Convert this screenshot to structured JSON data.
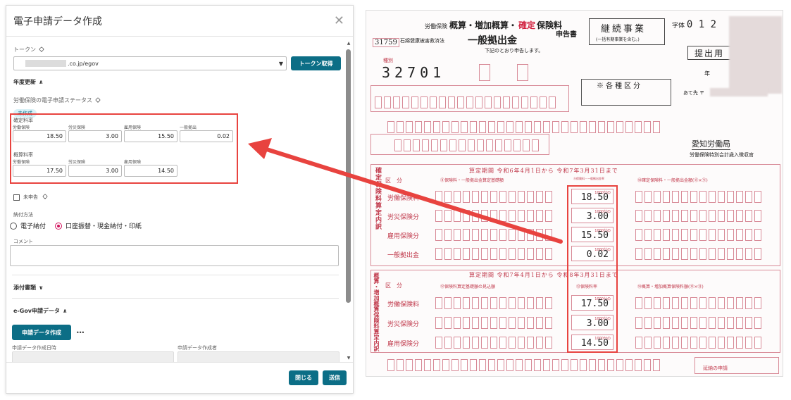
{
  "dialog": {
    "title": "電子申請データ作成",
    "token_label": "トークン",
    "token_value_suffix": ".co.jp/egov",
    "token_button": "トークン取得",
    "annual_update_header": "年度更新",
    "status_label": "労働保険の電子申請ステータス",
    "status_badge": "未作成",
    "fixed_rate_label": "確定料率",
    "fixed_rates": [
      {
        "label": "労働保険",
        "value": "18.50"
      },
      {
        "label": "労災保険",
        "value": "3.00"
      },
      {
        "label": "雇用保険",
        "value": "15.50"
      },
      {
        "label": "一般拠出",
        "value": "0.02"
      }
    ],
    "estimated_rate_label": "概算料率",
    "estimated_rates": [
      {
        "label": "労働保険",
        "value": "17.50"
      },
      {
        "label": "労災保険",
        "value": "3.00"
      },
      {
        "label": "雇用保険",
        "value": "14.50"
      }
    ],
    "not_applied_label": "未申告",
    "payment_method_label": "納付方法",
    "payment_options": [
      "電子納付",
      "口座振替・現金納付・印紙"
    ],
    "payment_selected": "口座振替・現金納付・印紙",
    "comment_label": "コメント",
    "attachments_header": "添付書類",
    "egov_header": "e-Gov申請データ",
    "create_button": "申請データ作成",
    "more_label": "•••",
    "created_at_label": "申請データ作成日時",
    "created_by_label": "申請データ作成者",
    "close_button": "閉じる",
    "send_button": "送信"
  },
  "form": {
    "code": "31759",
    "title_prefix": "労働保険",
    "title_main": "概算・増加概算・",
    "title_confirm": "確定",
    "title_insurance": "保険料",
    "title_sub": "石綿健康被害救済法",
    "title_levy": "一般拠出金",
    "title_report": "申告書",
    "continuing_business": "継続事業",
    "continuing_note": "(一括有期事業を含む。)",
    "submit_label": "提出用",
    "intro_line": "下記のとおり申告します。",
    "number_label": "種別",
    "type_number": "32701",
    "classification": "※各種区分",
    "addressee": "あて先 〒",
    "office": "愛知労働局",
    "office_sub": "労働保険特別会計歳入徴収官",
    "era_label": "年",
    "confirm_section_vertical": "確定保険料算定内訳",
    "estimate_section_vertical": "概算・増加概算保険料算定内訳",
    "period_confirm": "算定期間 令和6年4月1日から 令和7年3月31日まで",
    "period_estimate": "算定期間 令和7年4月1日から 令和8年3月31日まで",
    "col_base": "⑧保険料・一般拠出金算定基礎額",
    "col_rate": "⑨保険料・一般拠出金率",
    "col_amount": "⑩確定保険料・一般拠出金額(⑧×⑨)",
    "col_base2": "⑫保険料算定基礎額の見込額",
    "col_rate2": "⑬保険料率",
    "col_amount2": "⑭概算・増加概算保険料額(⑫×⑬)",
    "kubun": "区　分",
    "confirm_rows": [
      {
        "label": "労働保険料",
        "rate": "18.50"
      },
      {
        "label": "労災保険分",
        "rate": "3.00"
      },
      {
        "label": "雇用保険分",
        "rate": "15.50"
      },
      {
        "label": "一般拠出金",
        "rate": "0.02"
      }
    ],
    "estimate_rows": [
      {
        "label": "労働保険料",
        "rate": "17.50"
      },
      {
        "label": "労災保険分",
        "rate": "3.00"
      },
      {
        "label": "雇用保険分",
        "rate": "14.50"
      }
    ],
    "rate_unit": "1000分の",
    "delayed_label": "延納の申請"
  },
  "colors": {
    "accent": "#0c6e86",
    "highlight": "#e8433f",
    "form_red": "#c0384a",
    "radio_selected": "#d1115b"
  }
}
